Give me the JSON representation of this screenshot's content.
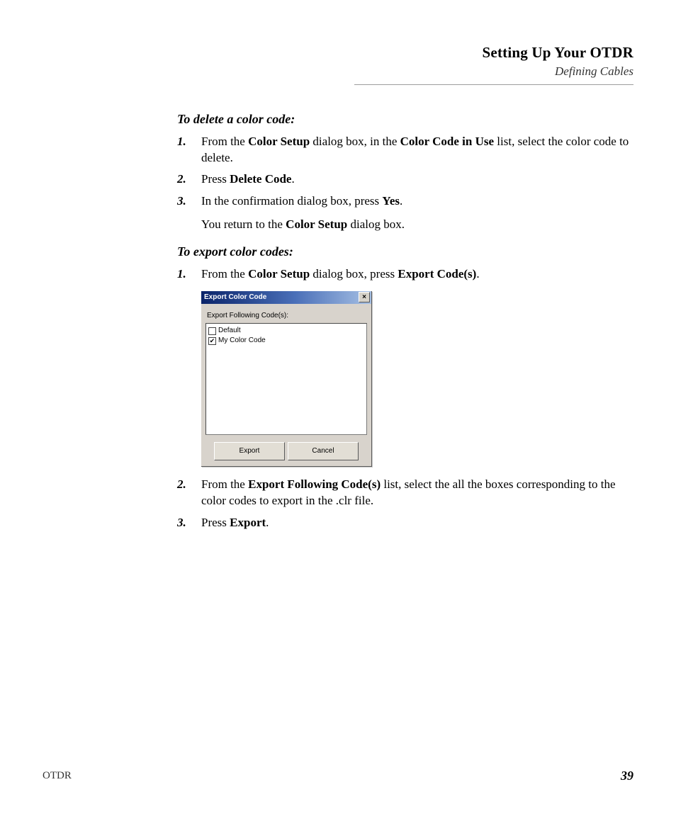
{
  "header": {
    "title": "Setting Up Your OTDR",
    "subtitle": "Defining Cables"
  },
  "section1": {
    "title": "To delete a color code:",
    "steps": {
      "s1": {
        "num": "1.",
        "pre": "From the ",
        "b1": "Color Setup",
        "mid": " dialog box, in the ",
        "b2": "Color Code in Use",
        "post": " list, select the color code to delete."
      },
      "s2": {
        "num": "2.",
        "pre": "Press ",
        "b1": "Delete Code",
        "post": "."
      },
      "s3": {
        "num": "3.",
        "line1_pre": "In the confirmation dialog box, press ",
        "line1_b": "Yes",
        "line1_post": ".",
        "line2_pre": "You return to the ",
        "line2_b": "Color Setup",
        "line2_post": " dialog box."
      }
    }
  },
  "section2": {
    "title": "To export color codes:",
    "steps": {
      "s1": {
        "num": "1.",
        "pre": "From the ",
        "b1": "Color Setup",
        "mid": " dialog box, press ",
        "b2": "Export Code(s)",
        "post": "."
      },
      "s2": {
        "num": "2.",
        "pre": "From the ",
        "b1": "Export Following Code(s)",
        "post": " list, select the all the boxes corresponding to the color codes to export in the .clr file."
      },
      "s3": {
        "num": "3.",
        "pre": "Press ",
        "b1": "Export",
        "post": "."
      }
    }
  },
  "dialog": {
    "title": "Export Color Code",
    "close_glyph": "×",
    "label": "Export Following Code(s):",
    "items": [
      {
        "checked": false,
        "label": "Default"
      },
      {
        "checked": true,
        "label": "My Color Code"
      }
    ],
    "check_glyph": "✔",
    "export_btn": "Export",
    "cancel_btn": "Cancel"
  },
  "footer": {
    "left": "OTDR",
    "right": "39"
  }
}
